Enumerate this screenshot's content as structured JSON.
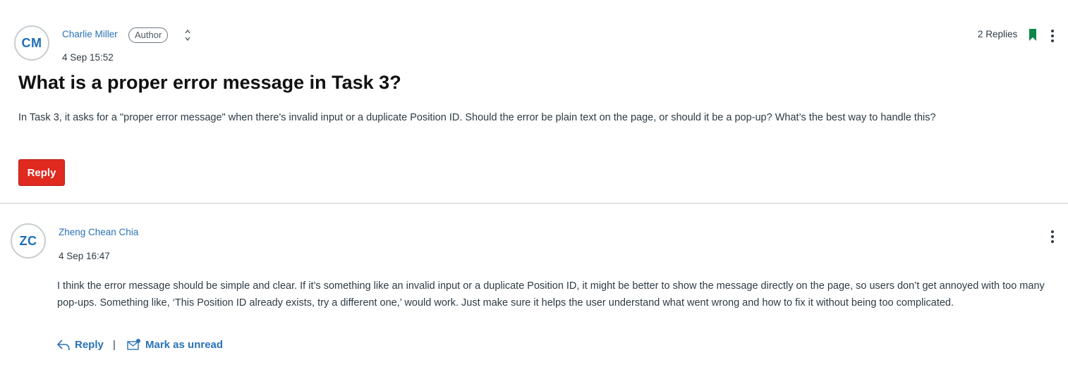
{
  "topic": {
    "author": {
      "initials": "CM",
      "name": "Charlie Miller",
      "role_badge": "Author",
      "timestamp": "4 Sep 15:52"
    },
    "replies_label": "2 Replies",
    "title": "What is a proper error message in Task 3?",
    "body": "In Task 3, it asks for a \"proper error message\" when there's invalid input or a duplicate Position ID. Should the error be plain text on the page, or should it be a pop-up? What’s the best way to handle this?",
    "reply_button_label": "Reply",
    "icons": {
      "sort": "sort-arrows-icon",
      "bookmark": "bookmark-icon",
      "menu": "kebab-menu-icon"
    },
    "bookmark_color": "#0b874b"
  },
  "replies": [
    {
      "author": {
        "initials": "ZC",
        "name": "Zheng Chean Chia",
        "timestamp": "4 Sep 16:47"
      },
      "body": "I think the error message should be simple and clear. If it’s something like an invalid input or a duplicate Position ID, it might be better to show the message directly on the page, so users don’t get annoyed with too many pop-ups. Something like, ‘This Position ID already exists, try a different one,’ would work. Just make sure it helps the user understand what went wrong and how to fix it without being too complicated.",
      "actions": {
        "reply_label": "Reply",
        "separator": "|",
        "mark_unread_label": "Mark as unread"
      },
      "icons": {
        "reply": "reply-arrow-icon",
        "mark_unread": "envelope-unread-icon",
        "menu": "kebab-menu-icon"
      }
    }
  ],
  "colors": {
    "link": "#2a72b5",
    "accent_button": "#e0291f",
    "avatar_text": "#1e6fb7"
  }
}
